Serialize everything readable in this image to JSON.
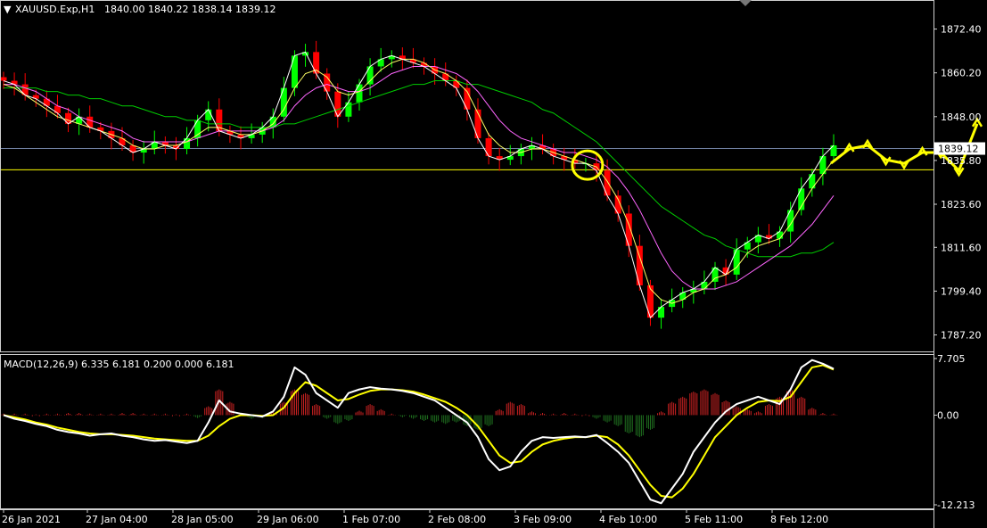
{
  "header": {
    "symbol": "XAUUSD.Exp,H1",
    "ohlc": "1840.00 1840.22 1838.14 1839.12"
  },
  "macd_header": {
    "text": "MACD(12,26,9) 6.335 6.181 0.200 0.000 6.181"
  },
  "colors": {
    "background": "#000000",
    "bull_candle": "#00ff00",
    "bear_candle": "#ff0000",
    "ma_fast": "#ffffff",
    "ma_yellow": "#ffff66",
    "ma_pink": "#ff66ff",
    "ma_green": "#00cc00",
    "macd_line": "#ffffff",
    "signal_line": "#ffff00",
    "hist_pos": "#cc2222",
    "hist_neg": "#1f6f1f",
    "price_level_line": "#6f7fa0",
    "support_line": "#ffff00",
    "annotation": "#ffff00"
  },
  "chart_data": [
    {
      "type": "candlestick",
      "panel": "price",
      "y_ticks": [
        "1872.40",
        "1860.20",
        "1848.00",
        "1835.80",
        "1823.60",
        "1811.60",
        "1799.40",
        "1787.20"
      ],
      "ylim": [
        1782.6,
        1880.0
      ],
      "current_price_label": "1839.12",
      "current_price": 1839.12,
      "support_level": 1833.2,
      "x_categories": [
        "26 Jan 2021",
        "27 Jan 04:00",
        "28 Jan 05:00",
        "29 Jan 06:00",
        "1 Feb 07:00",
        "2 Feb 08:00",
        "3 Feb 09:00",
        "4 Feb 10:00",
        "5 Feb 11:00",
        "8 Feb 12:00"
      ],
      "close_series": [
        1858,
        1857,
        1854,
        1853,
        1851,
        1849,
        1846,
        1848,
        1845,
        1844,
        1842,
        1840,
        1838,
        1839,
        1841,
        1840,
        1839,
        1842,
        1847,
        1850,
        1844,
        1843,
        1842,
        1843,
        1845,
        1848,
        1856,
        1865,
        1866,
        1860,
        1855,
        1848,
        1852,
        1857,
        1862,
        1864,
        1865,
        1864,
        1863,
        1862,
        1860,
        1858,
        1856,
        1850,
        1842,
        1837,
        1836,
        1837,
        1839,
        1840,
        1839,
        1837,
        1836,
        1835,
        1835,
        1833,
        1826,
        1821,
        1812,
        1801,
        1792,
        1795,
        1797,
        1799,
        1800,
        1802,
        1806,
        1804,
        1811,
        1813,
        1815,
        1814,
        1816,
        1822,
        1828,
        1832,
        1837,
        1840
      ],
      "ma_yellow": [
        1857,
        1856,
        1854,
        1852,
        1850,
        1848,
        1847,
        1846,
        1845,
        1844,
        1843,
        1842,
        1840,
        1839,
        1839,
        1840,
        1840,
        1841,
        1843,
        1845,
        1845,
        1844,
        1843,
        1843,
        1844,
        1846,
        1850,
        1856,
        1860,
        1861,
        1859,
        1855,
        1854,
        1855,
        1858,
        1861,
        1863,
        1864,
        1864,
        1863,
        1861,
        1860,
        1858,
        1855,
        1849,
        1843,
        1840,
        1838,
        1838,
        1839,
        1839,
        1838,
        1837,
        1836,
        1835,
        1834,
        1830,
        1825,
        1818,
        1809,
        1800,
        1797,
        1796,
        1797,
        1799,
        1800,
        1803,
        1804,
        1806,
        1810,
        1812,
        1813,
        1814,
        1818,
        1823,
        1828,
        1832,
        1836
      ],
      "ma_pink": [
        1857,
        1857,
        1856,
        1855,
        1853,
        1851,
        1850,
        1848,
        1847,
        1846,
        1845,
        1844,
        1842,
        1841,
        1841,
        1841,
        1841,
        1841,
        1842,
        1843,
        1844,
        1844,
        1844,
        1844,
        1844,
        1845,
        1847,
        1851,
        1854,
        1856,
        1857,
        1856,
        1855,
        1855,
        1856,
        1858,
        1860,
        1861,
        1862,
        1862,
        1862,
        1861,
        1860,
        1858,
        1855,
        1851,
        1847,
        1844,
        1842,
        1841,
        1840,
        1839,
        1838,
        1838,
        1837,
        1836,
        1834,
        1831,
        1827,
        1822,
        1816,
        1810,
        1805,
        1802,
        1800,
        1800,
        1800,
        1801,
        1802,
        1804,
        1806,
        1808,
        1810,
        1812,
        1815,
        1818,
        1822,
        1826
      ],
      "ma_green": [
        1856,
        1856,
        1856,
        1856,
        1855,
        1855,
        1854,
        1854,
        1853,
        1853,
        1852,
        1851,
        1851,
        1850,
        1849,
        1848,
        1848,
        1847,
        1847,
        1846,
        1846,
        1846,
        1845,
        1845,
        1845,
        1845,
        1846,
        1846,
        1847,
        1848,
        1849,
        1850,
        1851,
        1852,
        1853,
        1854,
        1855,
        1856,
        1857,
        1857,
        1858,
        1858,
        1858,
        1857,
        1857,
        1856,
        1855,
        1854,
        1853,
        1852,
        1850,
        1849,
        1847,
        1845,
        1843,
        1841,
        1838,
        1835,
        1832,
        1829,
        1826,
        1823,
        1821,
        1819,
        1817,
        1815,
        1814,
        1812,
        1811,
        1810,
        1809,
        1809,
        1809,
        1809,
        1810,
        1810,
        1811,
        1813
      ],
      "forecast_path": [
        1835,
        1839,
        1840,
        1836,
        1835,
        1838,
        1838,
        1833,
        1846
      ]
    },
    {
      "type": "macd",
      "panel": "indicator",
      "y_ticks": [
        "7.705",
        "0.00",
        "-12.213"
      ],
      "ylim": [
        -12.213,
        7.705
      ],
      "macd_values": [
        0.0,
        -0.5,
        -0.8,
        -1.2,
        -1.5,
        -2.0,
        -2.3,
        -2.5,
        -2.8,
        -2.6,
        -2.5,
        -2.8,
        -3.0,
        -3.3,
        -3.5,
        -3.4,
        -3.6,
        -3.8,
        -3.5,
        -1.0,
        2.0,
        0.5,
        0.2,
        0.0,
        -0.2,
        0.5,
        2.5,
        6.5,
        5.5,
        3.0,
        2.0,
        1.0,
        3.0,
        3.5,
        3.8,
        3.6,
        3.5,
        3.3,
        3.0,
        2.5,
        2.0,
        1.0,
        0.0,
        -1.0,
        -3.0,
        -6.0,
        -7.5,
        -7.0,
        -5.0,
        -3.5,
        -3.0,
        -3.1,
        -3.0,
        -2.9,
        -3.0,
        -2.7,
        -3.8,
        -5.0,
        -6.5,
        -9.0,
        -11.5,
        -12.0,
        -10.0,
        -8.0,
        -5.0,
        -3.0,
        -1.0,
        0.5,
        1.5,
        2.0,
        2.5,
        2.0,
        1.5,
        3.5,
        6.5,
        7.5,
        7.0,
        6.3
      ],
      "signal_values": [
        0.0,
        -0.3,
        -0.6,
        -1.0,
        -1.3,
        -1.7,
        -2.0,
        -2.3,
        -2.5,
        -2.6,
        -2.6,
        -2.7,
        -2.8,
        -3.0,
        -3.2,
        -3.3,
        -3.4,
        -3.5,
        -3.5,
        -2.8,
        -1.5,
        -0.5,
        0.0,
        0.0,
        -0.1,
        0.0,
        1.0,
        3.0,
        4.5,
        4.0,
        3.0,
        2.0,
        2.2,
        2.8,
        3.3,
        3.5,
        3.5,
        3.4,
        3.2,
        2.8,
        2.3,
        1.8,
        1.0,
        0.0,
        -1.5,
        -3.5,
        -5.5,
        -6.5,
        -6.3,
        -5.0,
        -4.0,
        -3.5,
        -3.2,
        -3.0,
        -3.0,
        -2.8,
        -3.0,
        -4.0,
        -5.5,
        -7.5,
        -9.5,
        -11.0,
        -11.2,
        -10.0,
        -8.0,
        -5.5,
        -3.0,
        -1.5,
        0.0,
        1.0,
        1.8,
        2.0,
        1.9,
        2.5,
        4.5,
        6.5,
        6.8,
        6.2
      ],
      "histogram": [
        0.2,
        0.2,
        0.2,
        0.1,
        0.2,
        0.2,
        0.3,
        0.3,
        0.2,
        0.2,
        0.2,
        0.3,
        0.3,
        0.2,
        0.2,
        0.2,
        0.1,
        0.2,
        -0.4,
        1.2,
        3.5,
        1.8,
        0.2,
        -0.5,
        -0.4,
        0.4,
        1.8,
        3.5,
        3.0,
        1.5,
        -0.5,
        -1.2,
        -0.8,
        0.6,
        1.5,
        0.8,
        0.2,
        -0.3,
        -0.5,
        -0.8,
        -1.0,
        -1.2,
        -1.0,
        -1.5,
        -2.0,
        -1.5,
        0.8,
        1.8,
        1.5,
        0.5,
        0.3,
        0.2,
        0.3,
        0.2,
        0.1,
        -0.5,
        -1.0,
        -1.5,
        -2.5,
        -3.0,
        -2.0,
        0.5,
        1.8,
        2.5,
        3.2,
        3.5,
        3.0,
        2.0,
        1.2,
        0.8,
        0.5,
        1.5,
        2.5,
        3.5,
        2.5,
        1.0,
        0.3,
        0.2
      ]
    }
  ]
}
